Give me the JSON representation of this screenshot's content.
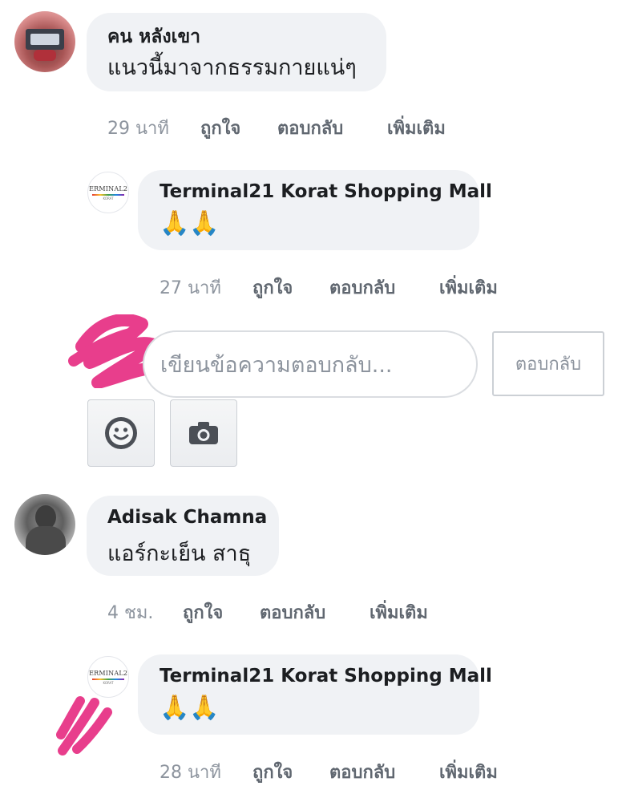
{
  "comments": [
    {
      "author": "คน หลังเขา",
      "text": "แนวนี้มาจากธรรมกายแน่ๆ",
      "time": "29 นาที",
      "actions": [
        "ถูกใจ",
        "ตอบกลับ",
        "เพิ่มเติม"
      ]
    },
    {
      "author": "Terminal21 Korat Shopping Mall",
      "text": "🙏🙏",
      "time": "27 นาที",
      "actions": [
        "ถูกใจ",
        "ตอบกลับ",
        "เพิ่มเติม"
      ],
      "logo_text": "TERMINAL21",
      "logo_sub": "KORAT"
    },
    {
      "author": "Adisak Chamna",
      "text": "แอร์กะเย็น สาธุ",
      "time": "4 ชม.",
      "actions": [
        "ถูกใจ",
        "ตอบกลับ",
        "เพิ่มเติม"
      ]
    },
    {
      "author": "Terminal21 Korat Shopping Mall",
      "text": "🙏🙏",
      "time": "28 นาที",
      "actions": [
        "ถูกใจ",
        "ตอบกลับ",
        "เพิ่มเติม"
      ],
      "logo_text": "TERMINAL21",
      "logo_sub": "KORAT"
    }
  ],
  "reply_box": {
    "placeholder": "เขียนข้อความตอบกลับ...",
    "submit_label": "ตอบกลับ"
  },
  "icons": {
    "emoji_button": "smiley-icon",
    "photo_button": "camera-icon"
  },
  "colors": {
    "bubble": "#f0f2f5",
    "scribble": "#e83e8c",
    "action_text": "#606770",
    "time_text": "#8d949e"
  }
}
